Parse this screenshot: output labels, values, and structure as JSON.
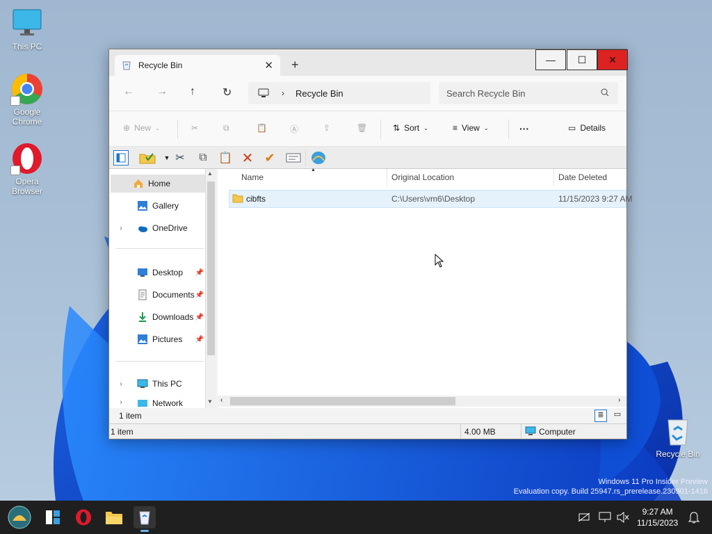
{
  "desktop": {
    "icons": [
      {
        "label": "This PC"
      },
      {
        "label": "Google Chrome"
      },
      {
        "label": "Opera Browser"
      },
      {
        "label": "Recycle Bin"
      }
    ],
    "watermark_line1": "Windows 11 Pro Insider Preview",
    "watermark_line2": "Evaluation copy. Build 25947.rs_prerelease.230901-1416"
  },
  "window": {
    "tab_title": "Recycle Bin",
    "tab_close": "✕",
    "new_tab": "+",
    "min": "—",
    "max": "☐",
    "close": "✕",
    "address_crumb": "Recycle Bin",
    "search_placeholder": "Search Recycle Bin",
    "commands": {
      "new": "New",
      "sort": "Sort",
      "view": "View",
      "more": "···",
      "details": "Details"
    },
    "nav": {
      "home": "Home",
      "gallery": "Gallery",
      "onedrive": "OneDrive",
      "desktop": "Desktop",
      "documents": "Documents",
      "downloads": "Downloads",
      "pictures": "Pictures",
      "thispc": "This PC",
      "network": "Network"
    },
    "columns": {
      "name": "Name",
      "original_location": "Original Location",
      "date_deleted": "Date Deleted"
    },
    "rows": [
      {
        "name": "cibfts",
        "original_location": "C:\\Users\\vm6\\Desktop",
        "date_deleted": "11/15/2023 9:27 AM"
      }
    ],
    "status_count": "1 item",
    "status2_count": "1 item",
    "status2_size": "4.00 MB",
    "status2_location": "Computer"
  },
  "taskbar": {
    "time": "9:27 AM",
    "date": "11/15/2023"
  },
  "colors": {
    "accent": "#0067c0",
    "close_red": "#d22222",
    "taskbar": "#1f1f1f",
    "selection": "#e5f1fb"
  }
}
